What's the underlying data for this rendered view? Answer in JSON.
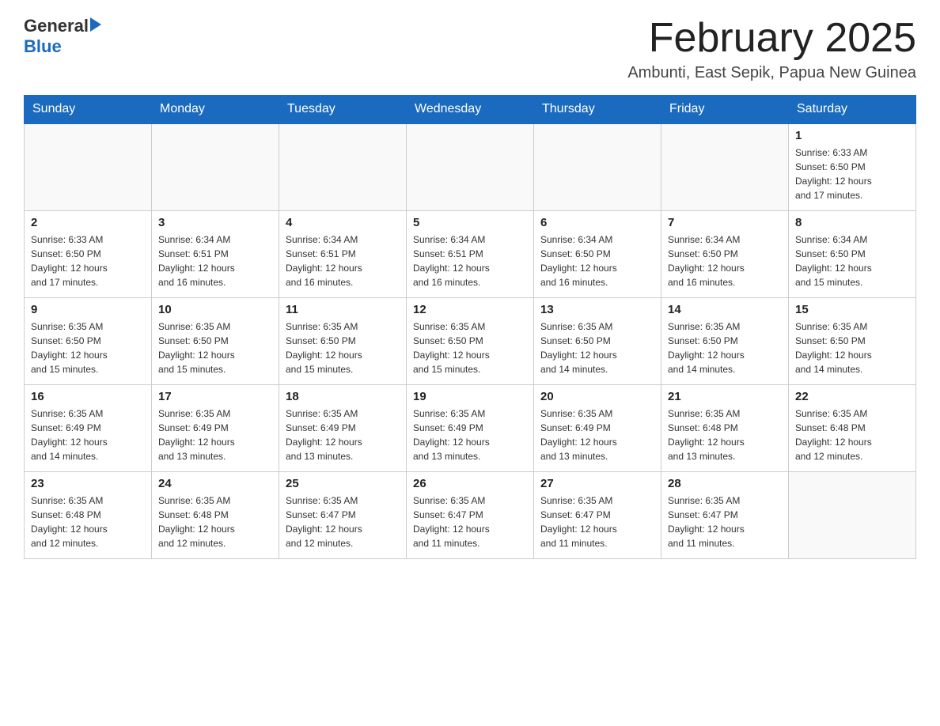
{
  "logo": {
    "general": "General",
    "blue": "Blue"
  },
  "title": "February 2025",
  "location": "Ambunti, East Sepik, Papua New Guinea",
  "days_of_week": [
    "Sunday",
    "Monday",
    "Tuesday",
    "Wednesday",
    "Thursday",
    "Friday",
    "Saturday"
  ],
  "weeks": [
    [
      {
        "day": "",
        "info": ""
      },
      {
        "day": "",
        "info": ""
      },
      {
        "day": "",
        "info": ""
      },
      {
        "day": "",
        "info": ""
      },
      {
        "day": "",
        "info": ""
      },
      {
        "day": "",
        "info": ""
      },
      {
        "day": "1",
        "info": "Sunrise: 6:33 AM\nSunset: 6:50 PM\nDaylight: 12 hours\nand 17 minutes."
      }
    ],
    [
      {
        "day": "2",
        "info": "Sunrise: 6:33 AM\nSunset: 6:50 PM\nDaylight: 12 hours\nand 17 minutes."
      },
      {
        "day": "3",
        "info": "Sunrise: 6:34 AM\nSunset: 6:51 PM\nDaylight: 12 hours\nand 16 minutes."
      },
      {
        "day": "4",
        "info": "Sunrise: 6:34 AM\nSunset: 6:51 PM\nDaylight: 12 hours\nand 16 minutes."
      },
      {
        "day": "5",
        "info": "Sunrise: 6:34 AM\nSunset: 6:51 PM\nDaylight: 12 hours\nand 16 minutes."
      },
      {
        "day": "6",
        "info": "Sunrise: 6:34 AM\nSunset: 6:50 PM\nDaylight: 12 hours\nand 16 minutes."
      },
      {
        "day": "7",
        "info": "Sunrise: 6:34 AM\nSunset: 6:50 PM\nDaylight: 12 hours\nand 16 minutes."
      },
      {
        "day": "8",
        "info": "Sunrise: 6:34 AM\nSunset: 6:50 PM\nDaylight: 12 hours\nand 15 minutes."
      }
    ],
    [
      {
        "day": "9",
        "info": "Sunrise: 6:35 AM\nSunset: 6:50 PM\nDaylight: 12 hours\nand 15 minutes."
      },
      {
        "day": "10",
        "info": "Sunrise: 6:35 AM\nSunset: 6:50 PM\nDaylight: 12 hours\nand 15 minutes."
      },
      {
        "day": "11",
        "info": "Sunrise: 6:35 AM\nSunset: 6:50 PM\nDaylight: 12 hours\nand 15 minutes."
      },
      {
        "day": "12",
        "info": "Sunrise: 6:35 AM\nSunset: 6:50 PM\nDaylight: 12 hours\nand 15 minutes."
      },
      {
        "day": "13",
        "info": "Sunrise: 6:35 AM\nSunset: 6:50 PM\nDaylight: 12 hours\nand 14 minutes."
      },
      {
        "day": "14",
        "info": "Sunrise: 6:35 AM\nSunset: 6:50 PM\nDaylight: 12 hours\nand 14 minutes."
      },
      {
        "day": "15",
        "info": "Sunrise: 6:35 AM\nSunset: 6:50 PM\nDaylight: 12 hours\nand 14 minutes."
      }
    ],
    [
      {
        "day": "16",
        "info": "Sunrise: 6:35 AM\nSunset: 6:49 PM\nDaylight: 12 hours\nand 14 minutes."
      },
      {
        "day": "17",
        "info": "Sunrise: 6:35 AM\nSunset: 6:49 PM\nDaylight: 12 hours\nand 13 minutes."
      },
      {
        "day": "18",
        "info": "Sunrise: 6:35 AM\nSunset: 6:49 PM\nDaylight: 12 hours\nand 13 minutes."
      },
      {
        "day": "19",
        "info": "Sunrise: 6:35 AM\nSunset: 6:49 PM\nDaylight: 12 hours\nand 13 minutes."
      },
      {
        "day": "20",
        "info": "Sunrise: 6:35 AM\nSunset: 6:49 PM\nDaylight: 12 hours\nand 13 minutes."
      },
      {
        "day": "21",
        "info": "Sunrise: 6:35 AM\nSunset: 6:48 PM\nDaylight: 12 hours\nand 13 minutes."
      },
      {
        "day": "22",
        "info": "Sunrise: 6:35 AM\nSunset: 6:48 PM\nDaylight: 12 hours\nand 12 minutes."
      }
    ],
    [
      {
        "day": "23",
        "info": "Sunrise: 6:35 AM\nSunset: 6:48 PM\nDaylight: 12 hours\nand 12 minutes."
      },
      {
        "day": "24",
        "info": "Sunrise: 6:35 AM\nSunset: 6:48 PM\nDaylight: 12 hours\nand 12 minutes."
      },
      {
        "day": "25",
        "info": "Sunrise: 6:35 AM\nSunset: 6:47 PM\nDaylight: 12 hours\nand 12 minutes."
      },
      {
        "day": "26",
        "info": "Sunrise: 6:35 AM\nSunset: 6:47 PM\nDaylight: 12 hours\nand 11 minutes."
      },
      {
        "day": "27",
        "info": "Sunrise: 6:35 AM\nSunset: 6:47 PM\nDaylight: 12 hours\nand 11 minutes."
      },
      {
        "day": "28",
        "info": "Sunrise: 6:35 AM\nSunset: 6:47 PM\nDaylight: 12 hours\nand 11 minutes."
      },
      {
        "day": "",
        "info": ""
      }
    ]
  ]
}
